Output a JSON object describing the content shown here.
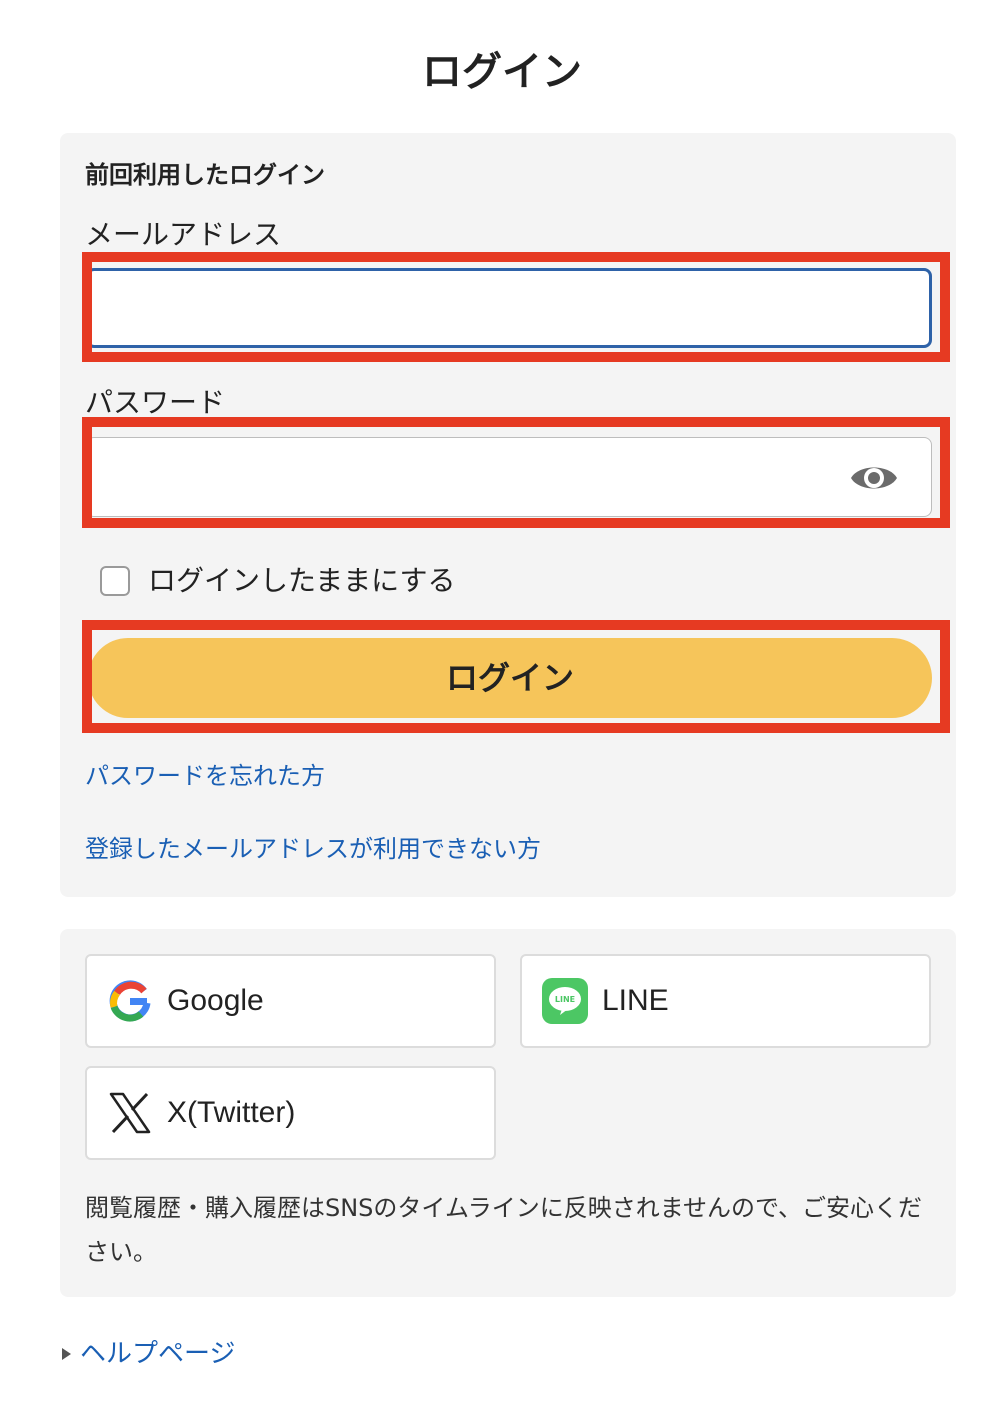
{
  "page": {
    "title": "ログイン"
  },
  "login_form": {
    "section_heading": "前回利用したログイン",
    "email_label": "メールアドレス",
    "email_value": "",
    "password_label": "パスワード",
    "password_value": "",
    "password_toggle_icon": "eye-icon",
    "remember_label": "ログインしたままにする",
    "remember_checked": false,
    "submit_label": "ログイン",
    "submit_color": "#f6c55a",
    "highlight_color": "#e63a22",
    "forgot_password_link": "パスワードを忘れた方",
    "cannot_use_email_link": "登録したメールアドレスが利用できない方",
    "link_color": "#1a5fb4"
  },
  "sns_login": {
    "buttons": [
      {
        "label": "Google",
        "icon": "google-icon"
      },
      {
        "label": "LINE",
        "icon": "line-icon"
      },
      {
        "label": "X(Twitter)",
        "icon": "x-twitter-icon"
      }
    ],
    "note": "閲覧履歴・購入履歴はSNSのタイムラインに反映されませんので、ご安心ください。"
  },
  "footer": {
    "help_link": "ヘルプページ"
  }
}
